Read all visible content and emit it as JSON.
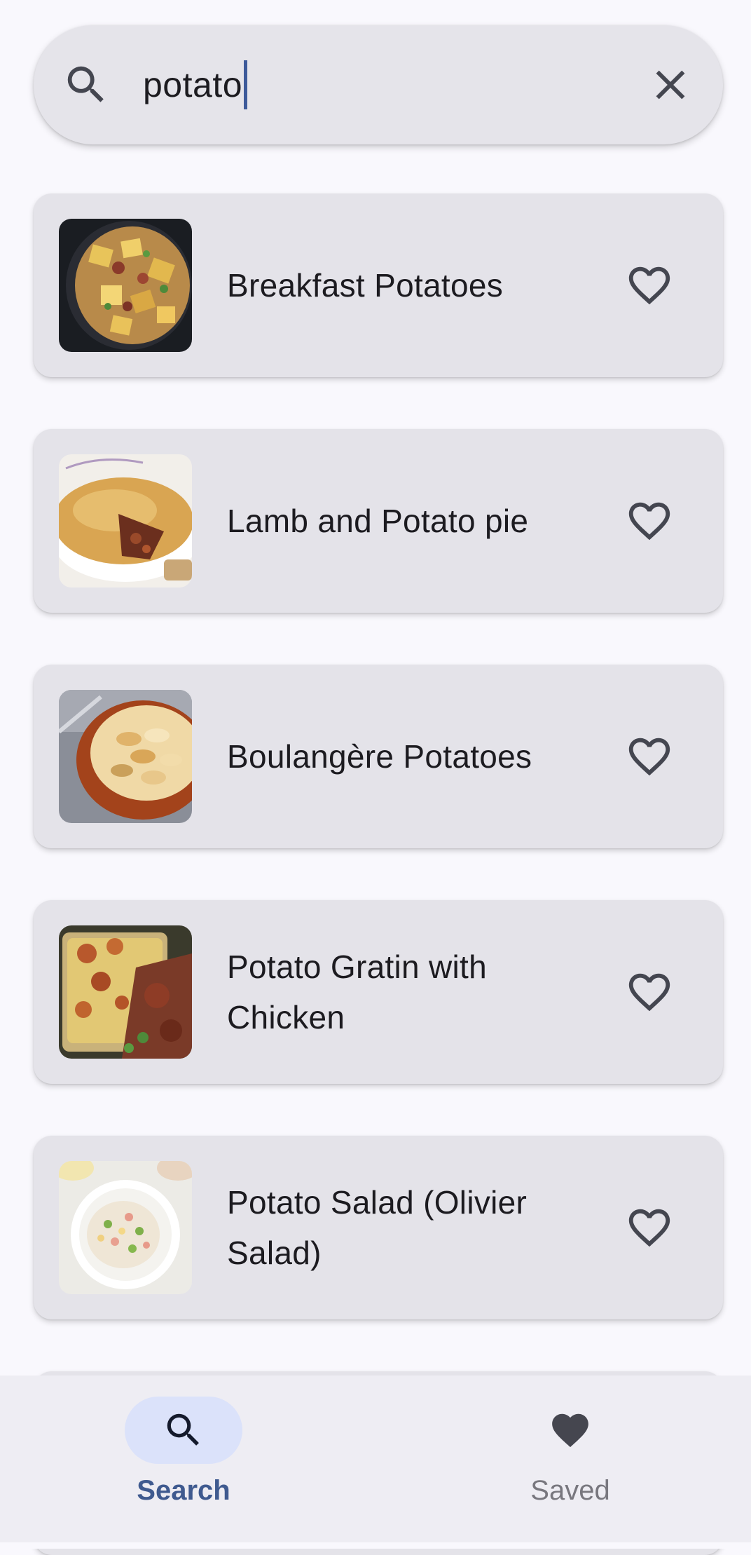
{
  "search": {
    "query": "potato",
    "search_icon": "search-icon",
    "clear_icon": "close-icon"
  },
  "results": [
    {
      "title": "Breakfast Potatoes"
    },
    {
      "title": "Lamb and Potato pie"
    },
    {
      "title": "Boulangère Potatoes"
    },
    {
      "title": "Potato Gratin with Chicken"
    },
    {
      "title": "Potato Salad (Olivier Salad)"
    }
  ],
  "nav": {
    "search_label": "Search",
    "saved_label": "Saved"
  },
  "colors": {
    "accent": "#3f5a8f",
    "nav_active_pill": "#dbe2fa",
    "card_background": "#e4e3e9"
  }
}
